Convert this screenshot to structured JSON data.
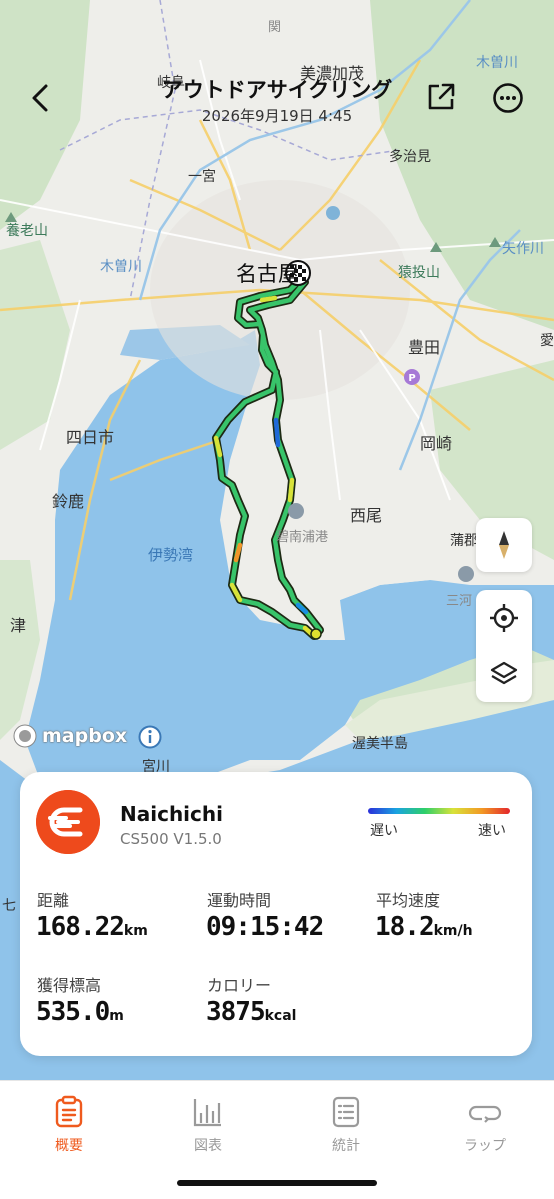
{
  "header": {
    "title": "アウトドアサイクリング",
    "datetime": "2026年9月19日 4:45"
  },
  "map": {
    "places": {
      "seki": "関",
      "gifu": "岐阜",
      "mino_kamo": "美濃加茂",
      "kisogawa_ne": "木曽川",
      "ichinomiya": "一宮",
      "tajimi": "多治見",
      "yoro": "養老山",
      "kisogawa": "木曽川",
      "nagoya": "名古屋",
      "sanage": "猿投山",
      "yahagi": "矢作川",
      "toyota": "豊田",
      "ai": "愛",
      "yokkaichi": "四日市",
      "okazaki": "岡崎",
      "suzuka": "鈴鹿",
      "nishio": "西尾",
      "hekinan": "碧南浦港",
      "isewan": "伊勢湾",
      "gamagori": "蒲郡",
      "mikawa": "三河",
      "tsu": "津",
      "atsumi": "渥美半島",
      "miyagawa": "宮川",
      "nana": "七"
    },
    "attribution": "mapbox"
  },
  "summary": {
    "device_name": "Naichichi",
    "device_model": "CS500  V1.5.0",
    "legend_slow": "遅い",
    "legend_fast": "速い",
    "distance_label": "距離",
    "distance_value": "168.22",
    "distance_unit": "km",
    "time_label": "運動時間",
    "time_value": "09:15:42",
    "avg_speed_label": "平均速度",
    "avg_speed_value": "18.2",
    "avg_speed_unit": "km/h",
    "elevation_label": "獲得標高",
    "elevation_value": "535.0",
    "elevation_unit": "m",
    "calories_label": "カロリー",
    "calories_value": "3875",
    "calories_unit": "kcal"
  },
  "tabs": {
    "overview": "概要",
    "charts": "図表",
    "stats": "統計",
    "laps": "ラップ"
  },
  "colors": {
    "accent": "#ef5a1e",
    "route_fast": "#2ecf6a",
    "water": "#8fc3ea"
  }
}
